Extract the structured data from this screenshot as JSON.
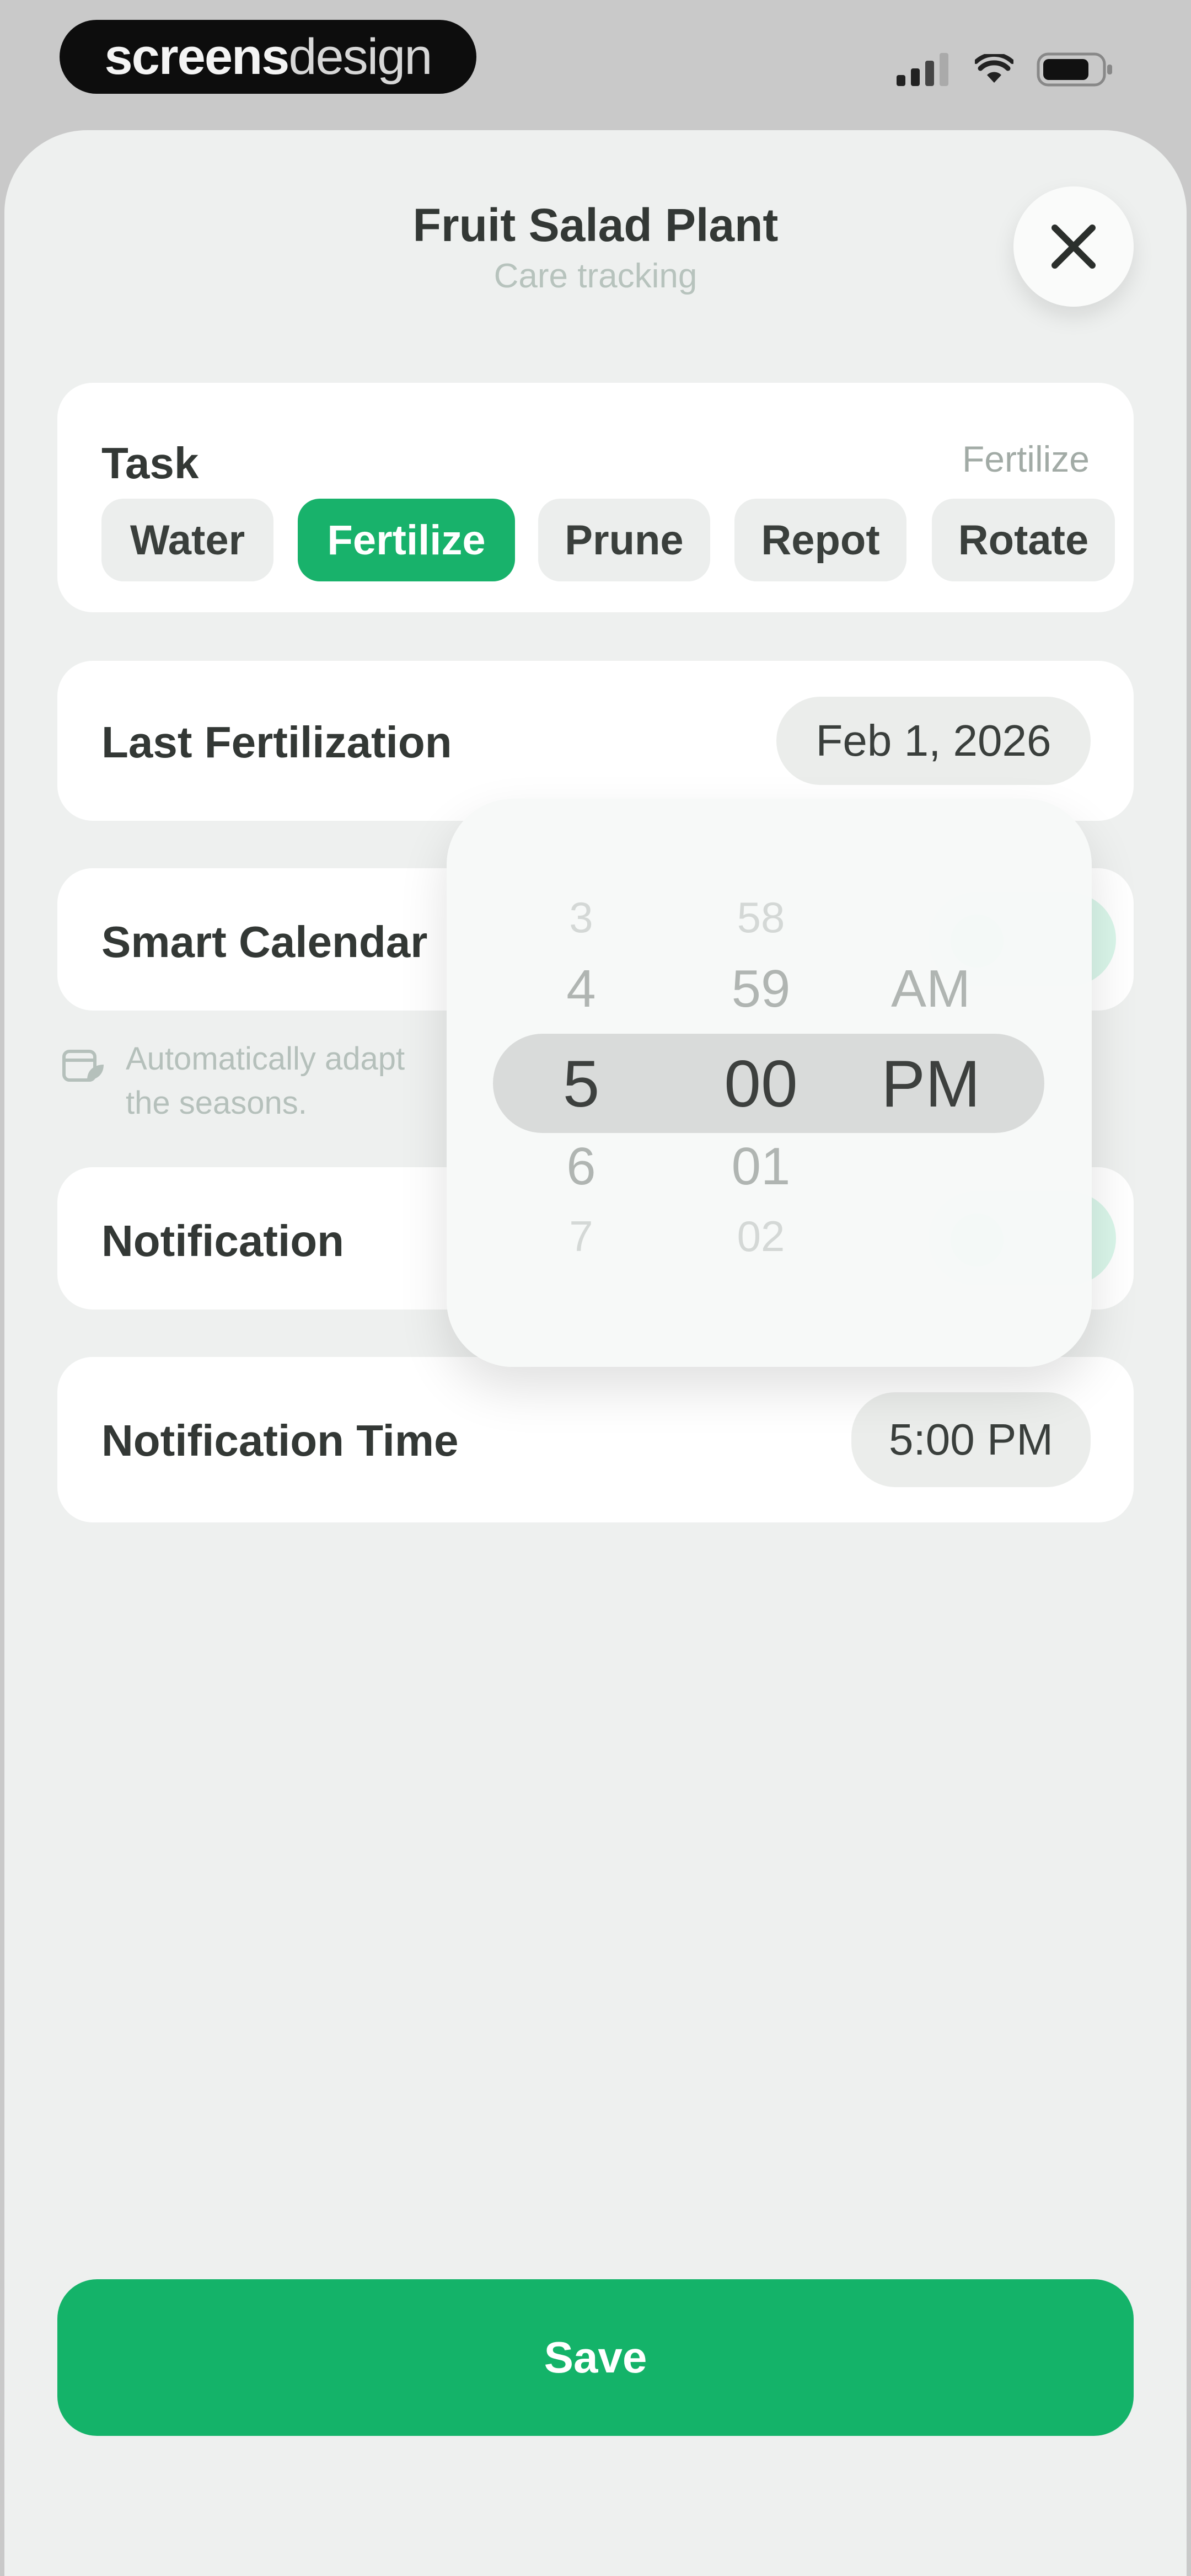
{
  "status_bar": {
    "brand_bold": "screens",
    "brand_light": "design"
  },
  "sheet": {
    "title": "Fruit Salad Plant",
    "subtitle": "Care tracking"
  },
  "task": {
    "label": "Task",
    "value": "Fertilize",
    "chips": [
      "Water",
      "Fertilize",
      "Prune",
      "Repot",
      "Rotate"
    ],
    "selected": "Fertilize"
  },
  "last_fertilization": {
    "label": "Last Fertilization",
    "value": "Feb 1, 2026"
  },
  "smart_calendar": {
    "label": "Smart Calendar",
    "note": "Automatically adapt\nthe seasons."
  },
  "notification": {
    "label": "Notification"
  },
  "notification_time": {
    "label": "Notification Time",
    "value": "5:00 PM"
  },
  "time_picker": {
    "hours": [
      "3",
      "4",
      "5",
      "6",
      "7"
    ],
    "minutes": [
      "58",
      "59",
      "00",
      "01",
      "02"
    ],
    "periods": [
      "AM",
      "PM"
    ]
  },
  "save_label": "Save",
  "colors": {
    "accent": "#18b26b",
    "background": "#eef0ef",
    "card": "#ffffff"
  }
}
